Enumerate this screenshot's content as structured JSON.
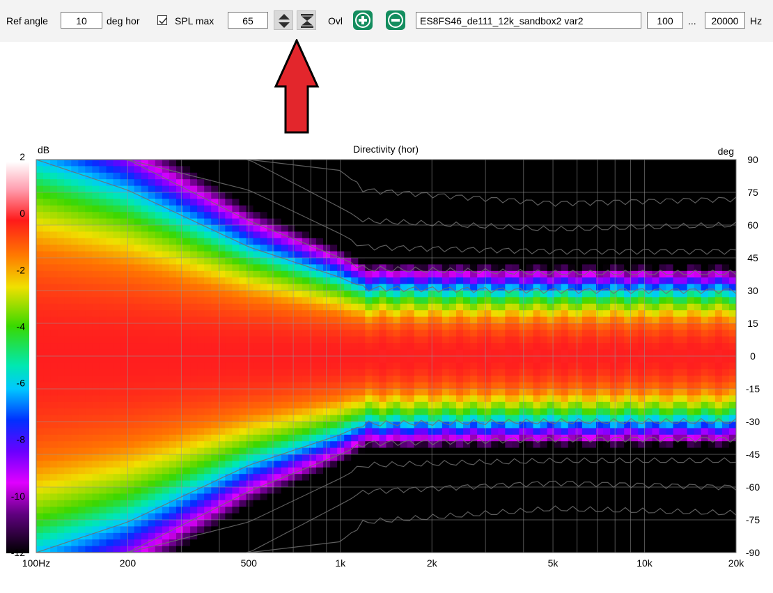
{
  "toolbar": {
    "ref_angle_label": "Ref angle",
    "ref_angle_value": "10",
    "deg_hor_label": "deg hor",
    "spl_max_checked": true,
    "spl_max_label": "SPL max",
    "spl_max_value": "65",
    "ovl_label": "Ovl",
    "dataset_name": "ES8FS46_de111_12k_sandbox2 var2",
    "freq_min": "100",
    "ellipsis": "...",
    "freq_max": "20000",
    "freq_unit": "Hz"
  },
  "icons": {
    "spinner": "up-down-spinner-icon",
    "fit": "fit-range-icon",
    "add": "add-overlay-icon",
    "remove": "remove-overlay-icon",
    "annotation": "red-up-arrow"
  },
  "colors": {
    "accent_green": "#138d5e",
    "annotation_red": "#e3262c"
  },
  "chart_data": {
    "type": "heatmap",
    "title": "Directivity (hor)",
    "colorbar_label": "dB",
    "yaxis_label": "deg",
    "x_scale": "log",
    "xlim": [
      100,
      20000
    ],
    "x_ticks": [
      100,
      200,
      500,
      1000,
      2000,
      5000,
      10000,
      20000
    ],
    "x_tick_labels": [
      "100Hz",
      "200",
      "500",
      "1k",
      "2k",
      "5k",
      "10k",
      "20k"
    ],
    "ylim": [
      -90,
      90
    ],
    "y_ticks": [
      90,
      75,
      60,
      45,
      30,
      15,
      0,
      -15,
      -30,
      -45,
      -60,
      -75,
      -90
    ],
    "y_tick_labels": [
      "90",
      "75",
      "60",
      "45",
      "30",
      "15",
      "0",
      "-15",
      "-30",
      "-45",
      "-60",
      "-75",
      "-90"
    ],
    "colorbar_range": [
      -12,
      2
    ],
    "colorbar_ticks": [
      2,
      0,
      -2,
      -4,
      -6,
      -8,
      -10,
      -12
    ],
    "colorbar_tick_labels": [
      "2",
      "0",
      "-2",
      "-4",
      "-6",
      "-8",
      "-10",
      "-12"
    ],
    "grid": true,
    "beamwidth_contours_deg": [
      {
        "freq": 100,
        "edges": [
          90,
          90,
          90,
          90,
          90
        ]
      },
      {
        "freq": 200,
        "edges": [
          90,
          90,
          90,
          90,
          76
        ]
      },
      {
        "freq": 500,
        "edges": [
          90,
          90,
          76,
          62,
          50
        ]
      },
      {
        "freq": 1000,
        "edges": [
          85,
          68,
          56,
          45,
          36
        ]
      },
      {
        "freq": 1200,
        "edges": [
          76,
          62,
          50,
          40,
          31
        ]
      },
      {
        "freq": 5000,
        "edges": [
          70,
          58,
          48,
          38,
          30
        ]
      },
      {
        "freq": 20000,
        "edges": [
          72,
          60,
          48,
          38,
          30
        ]
      }
    ]
  }
}
